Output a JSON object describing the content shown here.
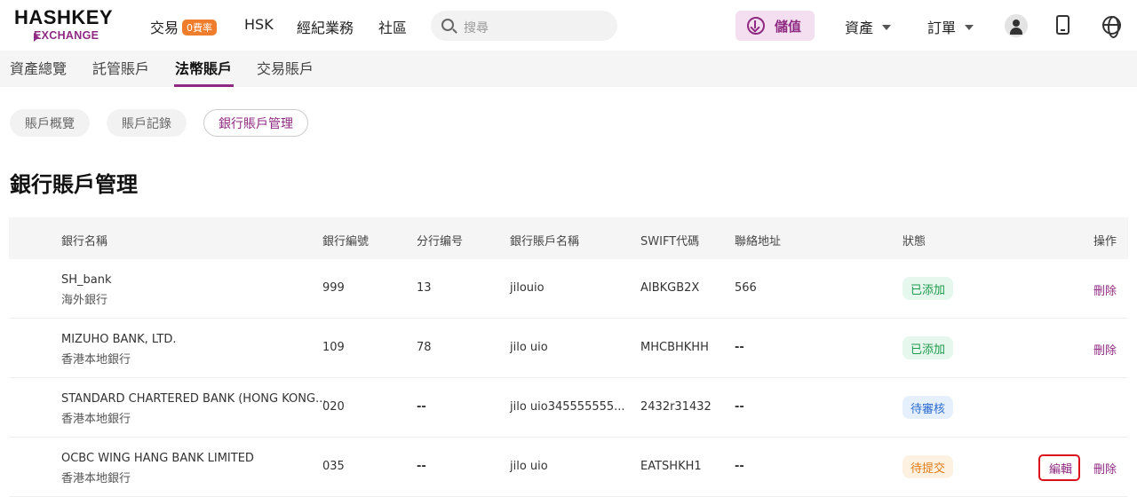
{
  "logo": {
    "line1": "HASHKEY",
    "line2": "EXCHANGE"
  },
  "nav": {
    "trade": "交易",
    "trade_badge": "0費率",
    "hsk": "HSK",
    "brokerage": "經紀業務",
    "community": "社區"
  },
  "search": {
    "placeholder": "搜尋"
  },
  "deposit_label": "儲值",
  "assets_label": "資產",
  "orders_label": "訂單",
  "tabs": [
    "資產總覽",
    "託管賬戶",
    "法幣賬戶",
    "交易賬戶"
  ],
  "subtabs": [
    "賬戶概覽",
    "賬戶記錄",
    "銀行賬戶管理"
  ],
  "page_title": "銀行賬戶管理",
  "table": {
    "headers": [
      "銀行名稱",
      "銀行編號",
      "分行编号",
      "銀行賬戶名稱",
      "SWIFT代碼",
      "聯絡地址",
      "狀態",
      "操作"
    ],
    "rows": [
      {
        "name": "SH_bank",
        "type": "海外銀行",
        "code": "999",
        "branch": "13",
        "account": "jilouio",
        "swift": "AIBKGB2X",
        "address": "566",
        "status": "已添加",
        "edit": "",
        "delete": "刪除"
      },
      {
        "name": "MIZUHO BANK, LTD.",
        "type": "香港本地銀行",
        "code": "109",
        "branch": "78",
        "account": "jilo uio",
        "swift": "MHCBHKHH",
        "address": "--",
        "status": "已添加",
        "edit": "",
        "delete": "刪除"
      },
      {
        "name": "STANDARD CHARTERED BANK (HONG KONG...",
        "type": "香港本地銀行",
        "code": "020",
        "branch": "--",
        "account": "jilo uio345555555...",
        "swift": "2432r31432",
        "address": "--",
        "status": "待審核",
        "edit": "",
        "delete": ""
      },
      {
        "name": "OCBC WING HANG BANK LIMITED",
        "type": "香港本地銀行",
        "code": "035",
        "branch": "--",
        "account": "jilo uio",
        "swift": "EATSHKH1",
        "address": "--",
        "status": "待提交",
        "edit": "編輯",
        "delete": "刪除"
      }
    ]
  },
  "colors": {
    "brand": "#8f2a82",
    "highlight_box": "#d9121c"
  }
}
